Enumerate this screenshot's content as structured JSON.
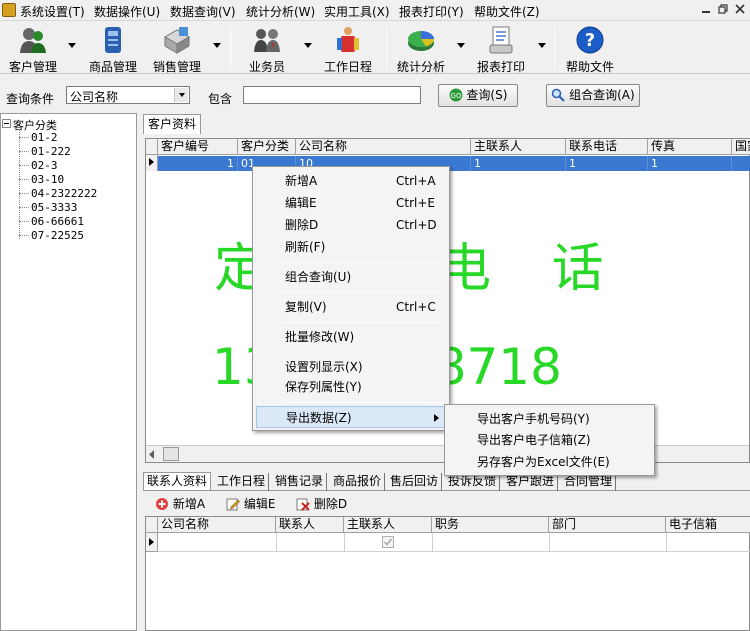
{
  "menubar": {
    "items": [
      "系统设置(T)",
      "数据操作(U)",
      "数据查询(V)",
      "统计分析(W)",
      "实用工具(X)",
      "报表打印(Y)",
      "帮助文件(Z)"
    ],
    "window_controls": [
      "minimize-icon",
      "restore-icon",
      "close-icon"
    ]
  },
  "toolbar": {
    "buttons": [
      {
        "label": "客户管理",
        "icon": "customer-management-icon",
        "dropdown": true
      },
      {
        "label": "商品管理",
        "icon": "product-management-icon",
        "dropdown": false
      },
      {
        "label": "销售管理",
        "icon": "sales-management-icon",
        "dropdown": true
      },
      {
        "label": "业务员",
        "icon": "salesperson-icon",
        "dropdown": true
      },
      {
        "label": "工作日程",
        "icon": "work-schedule-icon",
        "dropdown": false
      },
      {
        "label": "统计分析",
        "icon": "statistics-pie-icon",
        "dropdown": true
      },
      {
        "label": "报表打印",
        "icon": "report-print-icon",
        "dropdown": true
      },
      {
        "label": "帮助文件",
        "icon": "help-icon",
        "dropdown": false
      }
    ]
  },
  "query": {
    "condition_label": "查询条件",
    "condition_value": "公司名称",
    "contains_label": "包含",
    "contains_value": "",
    "query_button": "查询(S)",
    "combined_query_button": "组合查询(A)"
  },
  "tree": {
    "root": "客户分类",
    "nodes": [
      "01-2",
      "01-222",
      "02-3",
      "03-10",
      "04-2322222",
      "05-3333",
      "06-66661",
      "07-22525"
    ]
  },
  "top_tab": "客户资料",
  "customer_grid": {
    "headers": [
      "客户编号",
      "客户分类",
      "公司名称",
      "主联系人",
      "联系电话",
      "传真",
      "国家"
    ],
    "rows": [
      {
        "id": "1",
        "category": "01",
        "company": "10",
        "contact": "1",
        "phone": "1",
        "fax": "1",
        "country": ""
      }
    ]
  },
  "context_menu": {
    "items": [
      {
        "label": "新增A",
        "shortcut": "Ctrl+A"
      },
      {
        "label": "编辑E",
        "shortcut": "Ctrl+E"
      },
      {
        "label": "删除D",
        "shortcut": "Ctrl+D"
      },
      {
        "label": "刷新(F)",
        "shortcut": ""
      },
      {
        "label": "组合查询(U)",
        "shortcut": ""
      },
      {
        "label": "复制(V)",
        "shortcut": "Ctrl+C"
      },
      {
        "label": "批量修改(W)",
        "shortcut": ""
      },
      {
        "label": "设置列显示(X)",
        "shortcut": ""
      },
      {
        "label": "保存列属性(Y)",
        "shortcut": ""
      },
      {
        "label": "导出数据(Z)",
        "shortcut": ""
      }
    ],
    "submenu": [
      "导出客户手机号码(Y)",
      "导出客户电子信箱(Z)",
      "另存客户为Excel文件(E)"
    ]
  },
  "watermark": {
    "line1": "定 购 电 话",
    "line2": "13628228718",
    "color": "#27d827"
  },
  "bottom_tabs": [
    "联系人资料",
    "工作日程",
    "销售记录",
    "商品报价",
    "售后回访",
    "投诉反馈",
    "客户跟进",
    "合同管理"
  ],
  "bottom_toolbar": {
    "add": "新增A",
    "edit": "编辑E",
    "delete": "删除D"
  },
  "contact_grid": {
    "headers": [
      "公司名称",
      "联系人",
      "主联系人",
      "职务",
      "部门",
      "电子信箱"
    ],
    "rows": [
      {
        "company": "",
        "name": "",
        "primary": true,
        "title": "",
        "dept": "",
        "email": ""
      }
    ]
  },
  "colors": {
    "selection": "#3a78d2",
    "accent": "#1a6cc8",
    "watermark": "#27d827"
  }
}
